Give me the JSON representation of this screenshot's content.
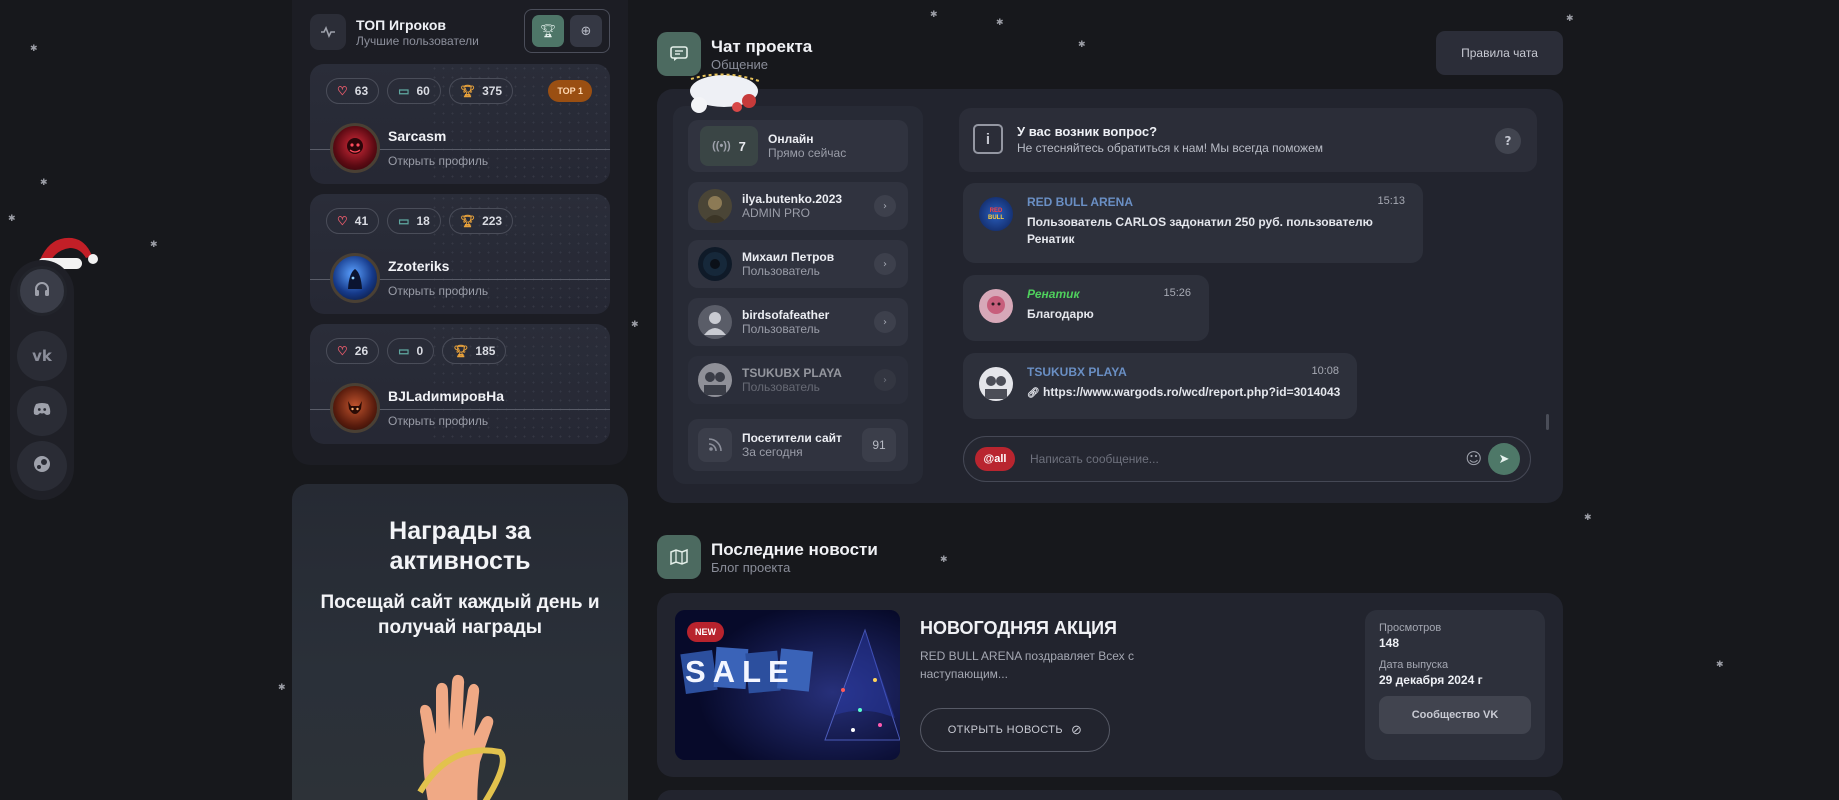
{
  "top_players": {
    "title": "ТОП Игроков",
    "subtitle": "Лучшие пользователи",
    "players": [
      {
        "likes": "63",
        "comments": "60",
        "trophies": "375",
        "badge": "TOP 1",
        "name": "Sarcasm",
        "link": "Открыть профиль"
      },
      {
        "likes": "41",
        "comments": "18",
        "trophies": "223",
        "badge": "",
        "name": "Zzoteriks",
        "link": "Открыть профиль"
      },
      {
        "likes": "26",
        "comments": "0",
        "trophies": "185",
        "badge": "",
        "name": "BJLadиmировHa",
        "link": "Открыть профиль"
      }
    ]
  },
  "rewards": {
    "title": "Награды за активность",
    "subtitle": "Посещай сайт каждый день и получай награды"
  },
  "chat": {
    "title": "Чат проекта",
    "subtitle": "Общение",
    "rules_button": "Правила чата",
    "online": {
      "count": "7",
      "title": "Онлайн",
      "subtitle": "Прямо сейчас"
    },
    "users": [
      {
        "name": "ilya.butenko.2023",
        "role": "ADMIN PRO"
      },
      {
        "name": "Михаил Петров",
        "role": "Пользователь"
      },
      {
        "name": "birdsofafeather",
        "role": "Пользователь"
      },
      {
        "name": "TSUKUBX PLAYA",
        "role": "Пользователь"
      }
    ],
    "visitors": {
      "title": "Посетители сайт",
      "subtitle": "За сегодня",
      "count": "91"
    },
    "question": {
      "title": "У вас возник вопрос?",
      "text": "Не стесняйтесь обратиться к нам! Мы всегда поможем",
      "help": "?"
    },
    "messages": [
      {
        "author": "RED BULL ARENA",
        "time": "15:13",
        "text_line1": "Пользователь CARLOS задонатил 250 руб. пользователю",
        "text_line2": "Ренатик"
      },
      {
        "author": "Ренатик",
        "time": "15:26",
        "text_line1": "Благодарю"
      },
      {
        "author": "TSUKUBX PLAYA",
        "time": "10:08",
        "text_line1": "https://www.wargods.ro/wcd/report.php?id=3014043"
      }
    ],
    "input": {
      "mention": "@all",
      "placeholder": "Написать сообщение..."
    }
  },
  "news": {
    "title": "Последние новости",
    "subtitle": "Блог проекта",
    "item": {
      "badge": "NEW",
      "image_text": "SALE",
      "headline": "НОВОГОДНЯЯ АКЦИЯ",
      "description": "RED BULL ARENA поздравляет Всех с наступающим...",
      "button": "ОТКРЫТЬ НОВОСТЬ",
      "views_label": "Просмотров",
      "views": "148",
      "date_label": "Дата выпуска",
      "date": "29 декабря 2024 г",
      "community_button": "Сообщество VK"
    }
  },
  "colors": {
    "accent": "#4e7868",
    "background": "#17181c",
    "card": "#22242e",
    "danger": "#b9252f",
    "trophy": "#e9a23b"
  },
  "icons": [
    "headset-icon",
    "vk-icon",
    "discord-icon",
    "steam-icon",
    "trophy-icon",
    "plus-circle-icon",
    "heart-icon",
    "comment-icon",
    "chat-icon",
    "antenna-icon",
    "chevron-right-icon",
    "rss-icon",
    "info-icon",
    "help-icon",
    "link-icon",
    "emoji-icon",
    "send-icon",
    "map-icon",
    "arrow-circle-icon"
  ]
}
